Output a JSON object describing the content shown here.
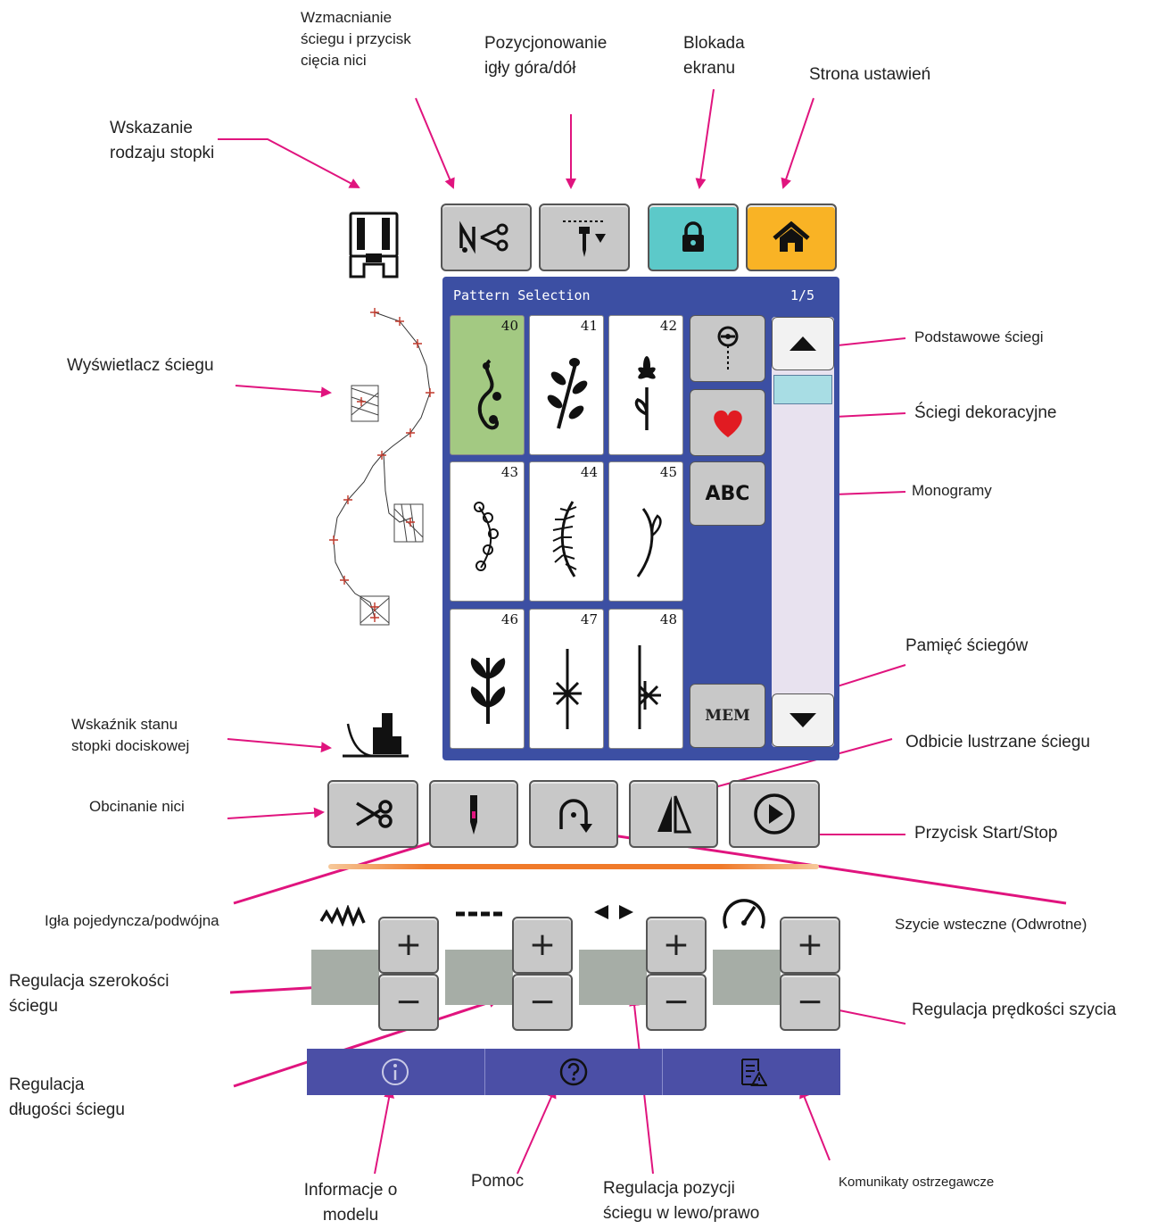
{
  "labels": {
    "wzmacnianie": "Wzmacnianie\nściegu i przycisk\ncięcia nici",
    "pozycjonowanie": "Pozycjonowanie\nigły góra/dół",
    "blokada": "Blokada\nekranu",
    "strona_ustawien": "Strona ustawień",
    "wskazanie_stopki": "Wskazanie\nrodzaju stopki",
    "wyswietlacz": "Wyświetlacz ściegu",
    "podstawowe": "Podstawowe ściegi",
    "dekoracyjne": "Ściegi dekoracyjne",
    "monogramy": "Monogramy",
    "pamiec": "Pamięć ściegów",
    "wskaznik_stanu": "Wskaźnik stanu\nstopki dociskowej",
    "odbicie": "Odbicie lustrzane ściegu",
    "obcinanie": "Obcinanie nici",
    "start_stop": "Przycisk Start/Stop",
    "igla": "Igła pojedyncza/podwójna",
    "wsteczne": "Szycie wsteczne (Odwrotne)",
    "szerokosc": "Regulacja szerokości\nściegu",
    "predkosc": "Regulacja prędkości szycia",
    "dlugosc": "Regulacja\ndługości ściegu",
    "informacje": "Informacje o\nmodelu",
    "pomoc": "Pomoc",
    "pozycja": "Regulacja pozycji\nściegu w lewo/prawo",
    "komunikaty": "Komunikaty ostrzegawcze"
  },
  "panel": {
    "title": "Pattern Selection",
    "page": "1/5",
    "patterns": [
      "40",
      "41",
      "42",
      "43",
      "44",
      "45",
      "46",
      "47",
      "48"
    ],
    "selected_index": 0,
    "abc_label": "ABC",
    "mem_label": "MEM"
  },
  "controls": {
    "plus": "+",
    "minus": "−"
  },
  "colors": {
    "panel_bg": "#3c4fa3",
    "selected_cell": "#a3c982",
    "lock_button": "#5cc9c9",
    "home_button": "#f9b325",
    "arrow": "#e0147e",
    "bottom_bar": "#4b4fa6",
    "separator": "#f07a2a"
  },
  "icons": [
    "presser-foot-icon",
    "reinforce-cut-icon",
    "needle-updown-icon",
    "lock-icon",
    "home-icon",
    "basic-stitch-icon",
    "heart-icon",
    "scroll-up-icon",
    "scroll-down-icon",
    "foot-state-icon",
    "scissors-icon",
    "needle-icon",
    "reverse-icon",
    "mirror-icon",
    "play-icon",
    "width-icon",
    "length-icon",
    "position-icon",
    "speed-icon",
    "info-icon",
    "help-icon",
    "warning-list-icon"
  ]
}
